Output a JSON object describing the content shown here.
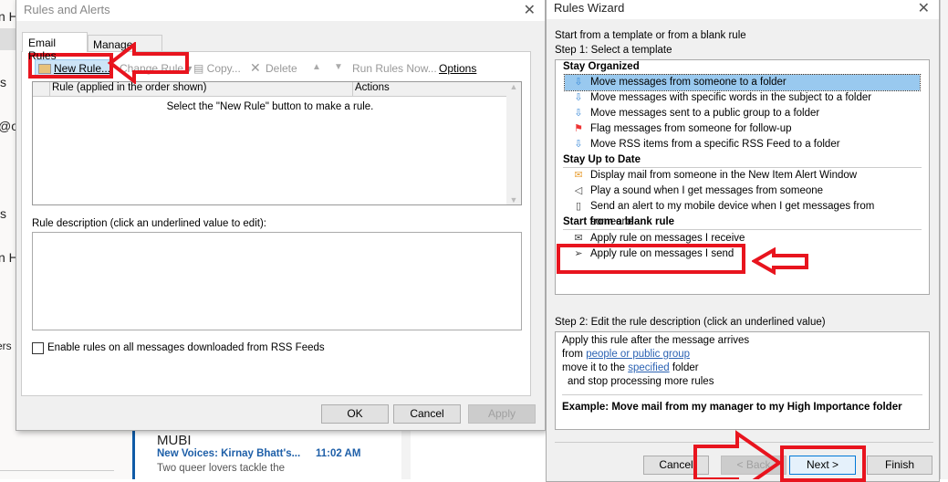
{
  "background": {
    "left_fragments": [
      "n Hi",
      "s",
      "@o",
      "s",
      "n Hi",
      "ers"
    ],
    "mail": {
      "sender": "MUBI",
      "subject": "New Voices: Kirnay Bhatt's...",
      "time": "11:02 AM",
      "preview": "Two queer lovers tackle the"
    }
  },
  "rules_alerts": {
    "title": "Rules and Alerts",
    "tabs": [
      "Email Rules",
      "Manage Alerts"
    ],
    "toolbar": {
      "new_rule": "New Rule...",
      "change_rule": "Change Rule",
      "copy": "Copy...",
      "delete": "Delete",
      "run_rules_now": "Run Rules Now...",
      "options": "Options"
    },
    "columns": [
      "Rule (applied in the order shown)",
      "Actions"
    ],
    "empty_message": "Select the \"New Rule\" button to make a rule.",
    "description_label": "Rule description (click an underlined value to edit):",
    "rss_checkbox": "Enable rules on all messages downloaded from RSS Feeds",
    "buttons": {
      "ok": "OK",
      "cancel": "Cancel",
      "apply": "Apply"
    }
  },
  "wizard": {
    "title": "Rules Wizard",
    "intro": "Start from a template or from a blank rule",
    "step1": "Step 1: Select a template",
    "groups": [
      {
        "name": "Stay Organized",
        "items": [
          {
            "label": "Move messages from someone to a folder",
            "icon": "move-folder-icon",
            "selected": true
          },
          {
            "label": "Move messages with specific words in the subject to a folder",
            "icon": "move-folder-icon"
          },
          {
            "label": "Move messages sent to a public group to a folder",
            "icon": "move-folder-icon"
          },
          {
            "label": "Flag messages from someone for follow-up",
            "icon": "flag-icon"
          },
          {
            "label": "Move RSS items from a specific RSS Feed to a folder",
            "icon": "move-folder-icon"
          }
        ]
      },
      {
        "name": "Stay Up to Date",
        "items": [
          {
            "label": "Display mail from someone in the New Item Alert Window",
            "icon": "alert-mail-icon"
          },
          {
            "label": "Play a sound when I get messages from someone",
            "icon": "speaker-icon"
          },
          {
            "label": "Send an alert to my mobile device when I get messages from someone",
            "icon": "mobile-icon"
          }
        ]
      },
      {
        "name": "Start from a blank rule",
        "items": [
          {
            "label": "Apply rule on messages I receive",
            "icon": "envelope-icon"
          },
          {
            "label": "Apply rule on messages I send",
            "icon": "send-icon"
          }
        ]
      }
    ],
    "step2": "Step 2: Edit the rule description (click an underlined value)",
    "desc": {
      "l1": "Apply this rule after the message arrives",
      "l2a": "from ",
      "l2link": "people or public group",
      "l3a": "move it to the ",
      "l3link": "specified",
      "l3b": " folder",
      "l4": "and stop processing more rules",
      "example": "Example: Move mail from my manager to my High Importance folder"
    },
    "buttons": {
      "cancel": "Cancel",
      "back": "< Back",
      "next": "Next >",
      "finish": "Finish"
    }
  },
  "colors": {
    "annotation_red": "#e8141e",
    "selection": "#99c9ef",
    "link": "#2b62b3"
  }
}
